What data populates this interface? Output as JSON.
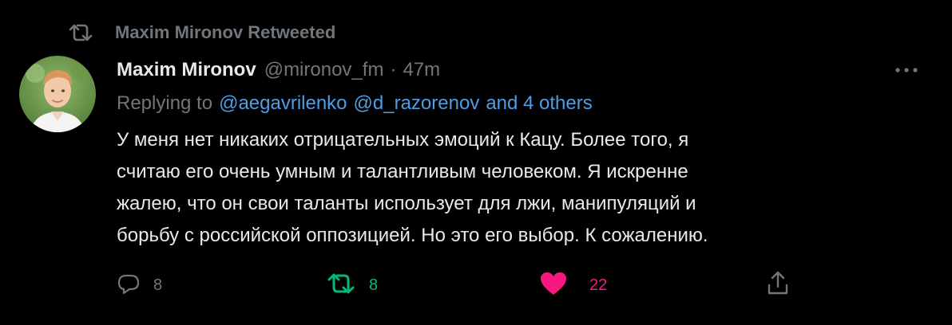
{
  "retweet_context": {
    "icon": "retweet-icon",
    "text": "Maxim Mironov Retweeted"
  },
  "tweet": {
    "author": {
      "display_name": "Maxim Mironov",
      "handle": "@mironov_fm",
      "separator": "·",
      "timestamp": "47m",
      "avatar_icon": "avatar"
    },
    "more_icon": "more-dots-icon",
    "replying": {
      "prefix": "Replying to",
      "mentions": [
        "@aegavrilenko",
        "@d_razorenov",
        "and 4 others"
      ]
    },
    "body_lines": [
      "У меня нет никаких отрицательных эмоций к Кацу. Более того, я",
      "считаю его очень умным и талантливым человеком. Я искренне",
      "жалею, что он свои таланты использует для лжи, манипуляций и",
      "борьбу с российской оппозицией. Но это его выбор. К сожалению."
    ],
    "actions": {
      "reply": {
        "icon": "reply-icon",
        "count": "8"
      },
      "retweet": {
        "icon": "retweet-icon",
        "count": "8",
        "active": true
      },
      "like": {
        "icon": "heart-icon",
        "count": "22",
        "active": true
      },
      "share": {
        "icon": "share-icon"
      }
    }
  },
  "colors": {
    "background": "#000000",
    "text": "#e7e9ea",
    "muted": "#71767b",
    "link": "#4d9ee6",
    "retweet_green": "#00ba7c",
    "like_pink": "#f91880"
  }
}
